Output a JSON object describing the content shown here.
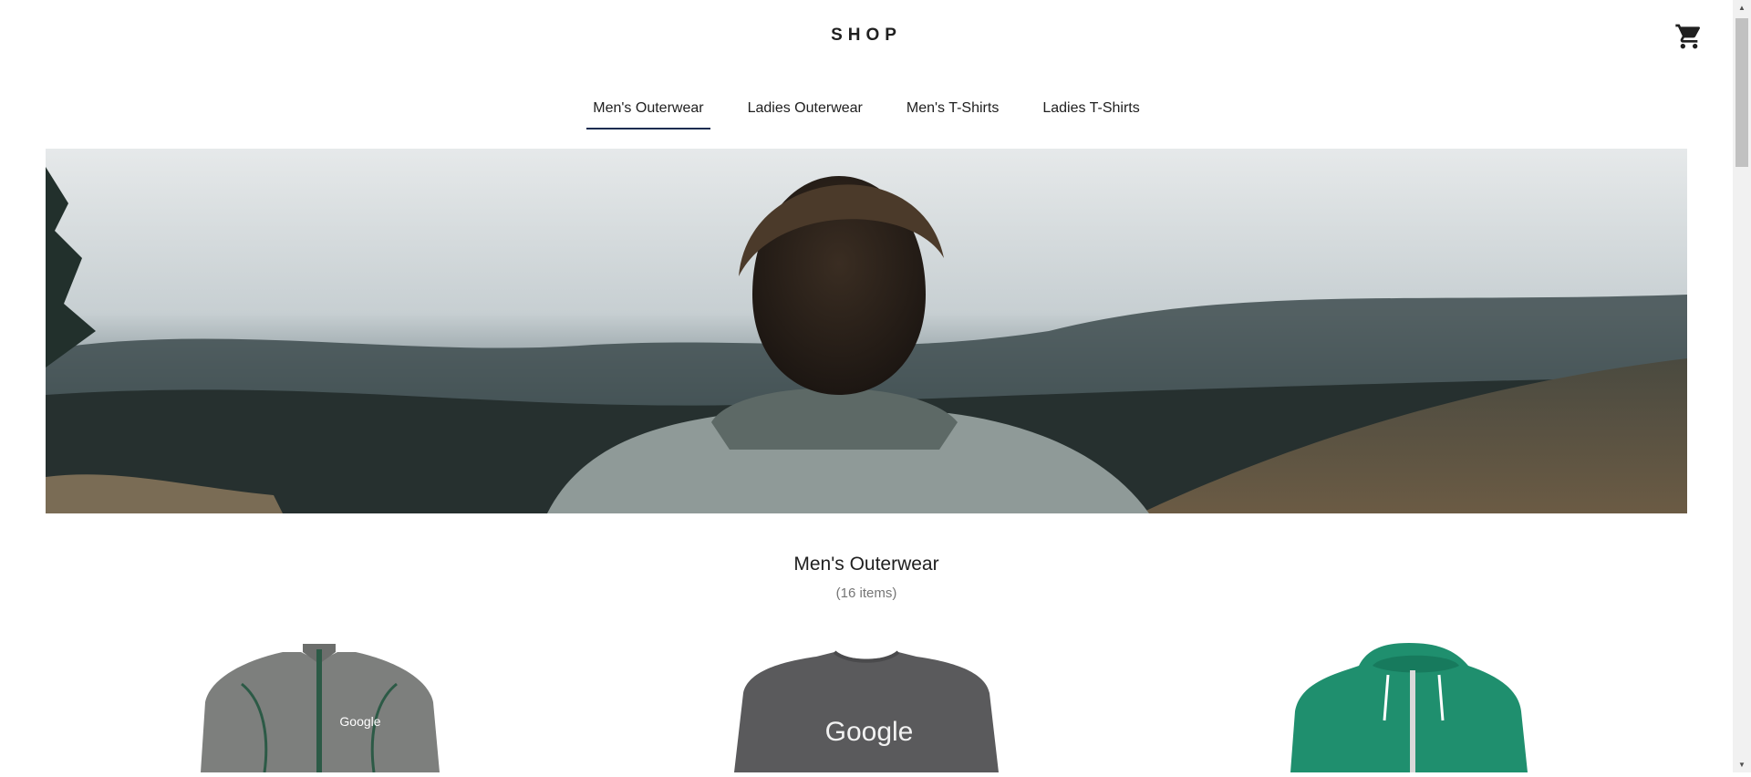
{
  "header": {
    "logo": "SHOP",
    "cart_icon": "shopping-cart-icon"
  },
  "nav": {
    "tabs": [
      {
        "label": "Men's Outerwear",
        "active": true
      },
      {
        "label": "Ladies Outerwear",
        "active": false
      },
      {
        "label": "Men's T-Shirts",
        "active": false
      },
      {
        "label": "Ladies T-Shirts",
        "active": false
      }
    ]
  },
  "category": {
    "title": "Men's Outerwear",
    "count": "(16 items)"
  },
  "products": [
    {
      "logo_text": "Google",
      "color": "#7d7f7d"
    },
    {
      "logo_text": "Google",
      "color": "#5a5a5c"
    },
    {
      "logo_text": "",
      "color": "#1f8f6e"
    }
  ],
  "colors": {
    "accent": "#172c50",
    "text": "#202020",
    "muted": "#757575"
  }
}
